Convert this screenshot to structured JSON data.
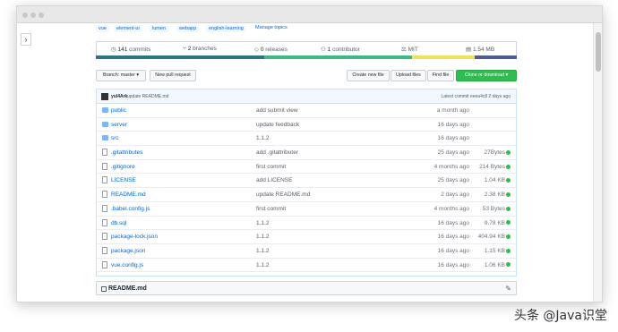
{
  "window": {
    "dots": [
      "#c8c8c8",
      "#c8c8c8",
      "#c8c8c8"
    ],
    "sidebar_toggle_glyph": "›"
  },
  "topics": [
    "vue",
    "element-ui",
    "lumen",
    "webapp",
    "english-learning"
  ],
  "manage_topics": "Manage topics",
  "stats": {
    "commits": "141",
    "commits_label": "commits",
    "branches": "2",
    "branches_label": "branches",
    "releases": "0",
    "releases_label": "releases",
    "contributors": "1",
    "contributors_label": "contributor",
    "license": "MIT",
    "size": "1.54 MB"
  },
  "language_bar": [
    {
      "color": "#2b7489",
      "share": 0.4
    },
    {
      "color": "#41b883",
      "share": 0.35
    },
    {
      "color": "#f1e05a",
      "share": 0.15
    },
    {
      "color": "#4f5d95",
      "share": 0.1
    }
  ],
  "controls": {
    "branch": "Branch: master",
    "new_pr": "New pull request",
    "create_file": "Create new file",
    "upload": "Upload files",
    "find": "Find file",
    "clone": "Clone or download"
  },
  "commit": {
    "author": "yul4Ark",
    "message": "update README.md",
    "latest": "Latest commit",
    "hash": "eeea4c8",
    "age": "2 days ago"
  },
  "files": [
    {
      "name": "public",
      "type": "dir",
      "message": "add submit view",
      "age": "a month ago",
      "size": ""
    },
    {
      "name": "server",
      "type": "dir",
      "message": "update feedback",
      "age": "16 days ago",
      "size": ""
    },
    {
      "name": "src",
      "type": "dir",
      "message": "1.1.2",
      "age": "16 days ago",
      "size": ""
    },
    {
      "name": ".gitattributes",
      "type": "file",
      "message": "add .gitattributer",
      "age": "25 days ago",
      "size": "27Bytes"
    },
    {
      "name": ".gitignore",
      "type": "file",
      "message": "first commit",
      "age": "4 months ago",
      "size": "214 Bytes"
    },
    {
      "name": "LICENSE",
      "type": "file",
      "message": "add LICENSE",
      "age": "25 days ago",
      "size": "1.04 KB"
    },
    {
      "name": "README.md",
      "type": "file",
      "message": "update README.md",
      "age": "2 days ago",
      "size": "2.38 KB"
    },
    {
      "name": ".babel.config.js",
      "type": "file",
      "message": "first commit",
      "age": "4 months ago",
      "size": "53 Bytes"
    },
    {
      "name": "db.sql",
      "type": "file",
      "message": "1.1.2",
      "age": "16 days ago",
      "size": "9.78 KB"
    },
    {
      "name": "package-lock.json",
      "type": "file",
      "message": "1.1.2",
      "age": "16 days ago",
      "size": "404.94 KB"
    },
    {
      "name": "package.json",
      "type": "file",
      "message": "1.1.2",
      "age": "16 days ago",
      "size": "1.15 KB"
    },
    {
      "name": "vue.config.js",
      "type": "file",
      "message": "1.1.2",
      "age": "16 days ago",
      "size": "1.06 KB"
    }
  ],
  "readme": {
    "title": "README.md",
    "edit_glyph": "✎"
  },
  "watermark": "头条 @Java识堂"
}
